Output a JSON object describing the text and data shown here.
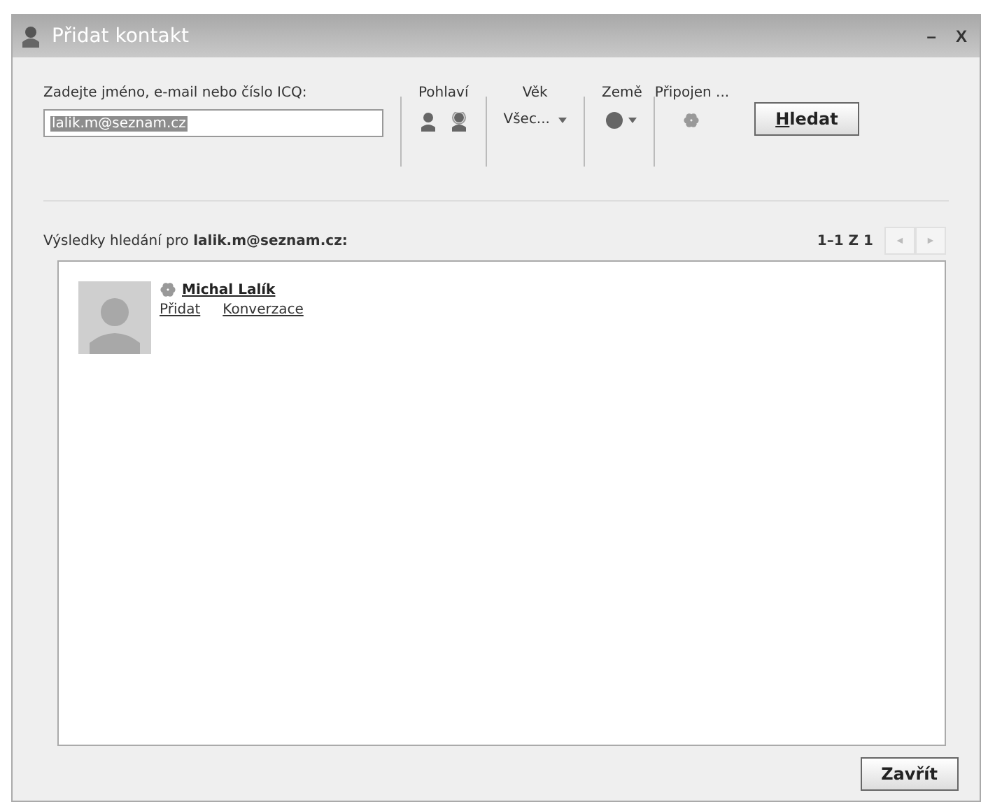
{
  "window": {
    "title": "Přidat kontakt",
    "controls": [
      "–",
      "X"
    ]
  },
  "search": {
    "label": "Zadejte jméno, e-mail nebo číslo ICQ:",
    "value": "lalik.m@seznam.cz"
  },
  "filters": {
    "gender_label": "Pohlaví",
    "age_label": "Věk",
    "age_value": "Všec...",
    "country_label": "Země",
    "online_label": "Připojen ..."
  },
  "search_button": "Hledat",
  "results": {
    "label": "Výsledky hledání pro **lalik.m@seznam.cz:**",
    "pager": "1–1 Z 1",
    "prev": "◄",
    "next": "►",
    "items": [
      {
        "name": "Michal Lalík",
        "actions": [
          "Přidat",
          "Konverzace"
        ]
      }
    ]
  },
  "close_button": "Zavřít"
}
